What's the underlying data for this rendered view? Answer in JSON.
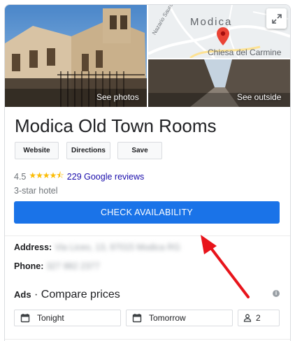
{
  "photos": {
    "main_caption": "See photos",
    "outside_caption": "See outside",
    "map_city": "Modica",
    "map_place": "Chiesa del Carmine",
    "map_street": "Nazario Sauro"
  },
  "hotel": {
    "name": "Modica Old Town Rooms",
    "rating": "4.5",
    "stars_icon": "★★★★⯪",
    "reviews": "229 Google reviews",
    "class": "3-star hotel"
  },
  "actions": {
    "website": "Website",
    "directions": "Directions",
    "save": "Save"
  },
  "cta": "CHECK AVAILABILITY",
  "address": {
    "label": "Address:",
    "value": "Via Liceo, 13, 97015 Modica RG"
  },
  "phone": {
    "label": "Phone:",
    "value": "327 882 2377"
  },
  "ads": {
    "label": "Ads",
    "separator": " · ",
    "title": "Compare prices",
    "info_icon": "i"
  },
  "booking": {
    "checkin": "Tonight",
    "checkout": "Tomorrow",
    "guests": "2"
  },
  "colors": {
    "accent": "#1a73e8",
    "link": "#1a0dab",
    "star": "#fbbc04",
    "arrow": "#e8141b"
  }
}
